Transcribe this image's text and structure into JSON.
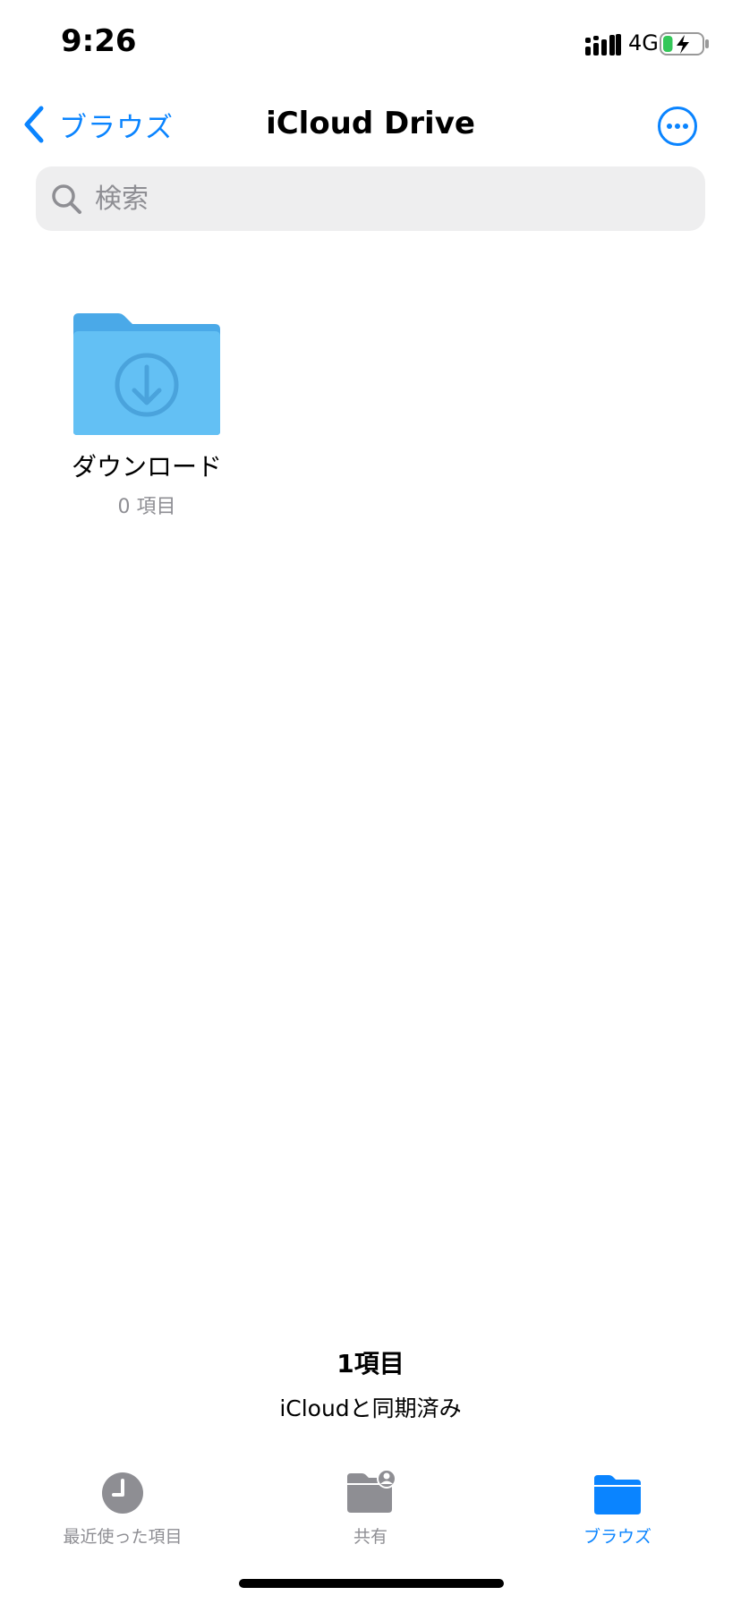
{
  "status_bar": {
    "time": "9:26",
    "network": "4G",
    "battery_fill": 0.25,
    "battery_color": "#34c759"
  },
  "nav": {
    "back_label": "ブラウズ",
    "title": "iCloud Drive",
    "accent_color": "#0a84ff"
  },
  "search": {
    "placeholder": "検索"
  },
  "items": [
    {
      "name": "ダウンロード",
      "count": "0 項目",
      "icon": "folder-download-icon",
      "color": "#5ab8ef"
    }
  ],
  "footer": {
    "count": "1項目",
    "sync_status": "iCloudと同期済み"
  },
  "tabbar": {
    "tabs": [
      {
        "label": "最近使った項目",
        "icon": "clock-icon",
        "active": false
      },
      {
        "label": "共有",
        "icon": "shared-folder-icon",
        "active": false
      },
      {
        "label": "ブラウズ",
        "icon": "folder-icon",
        "active": true
      }
    ]
  }
}
